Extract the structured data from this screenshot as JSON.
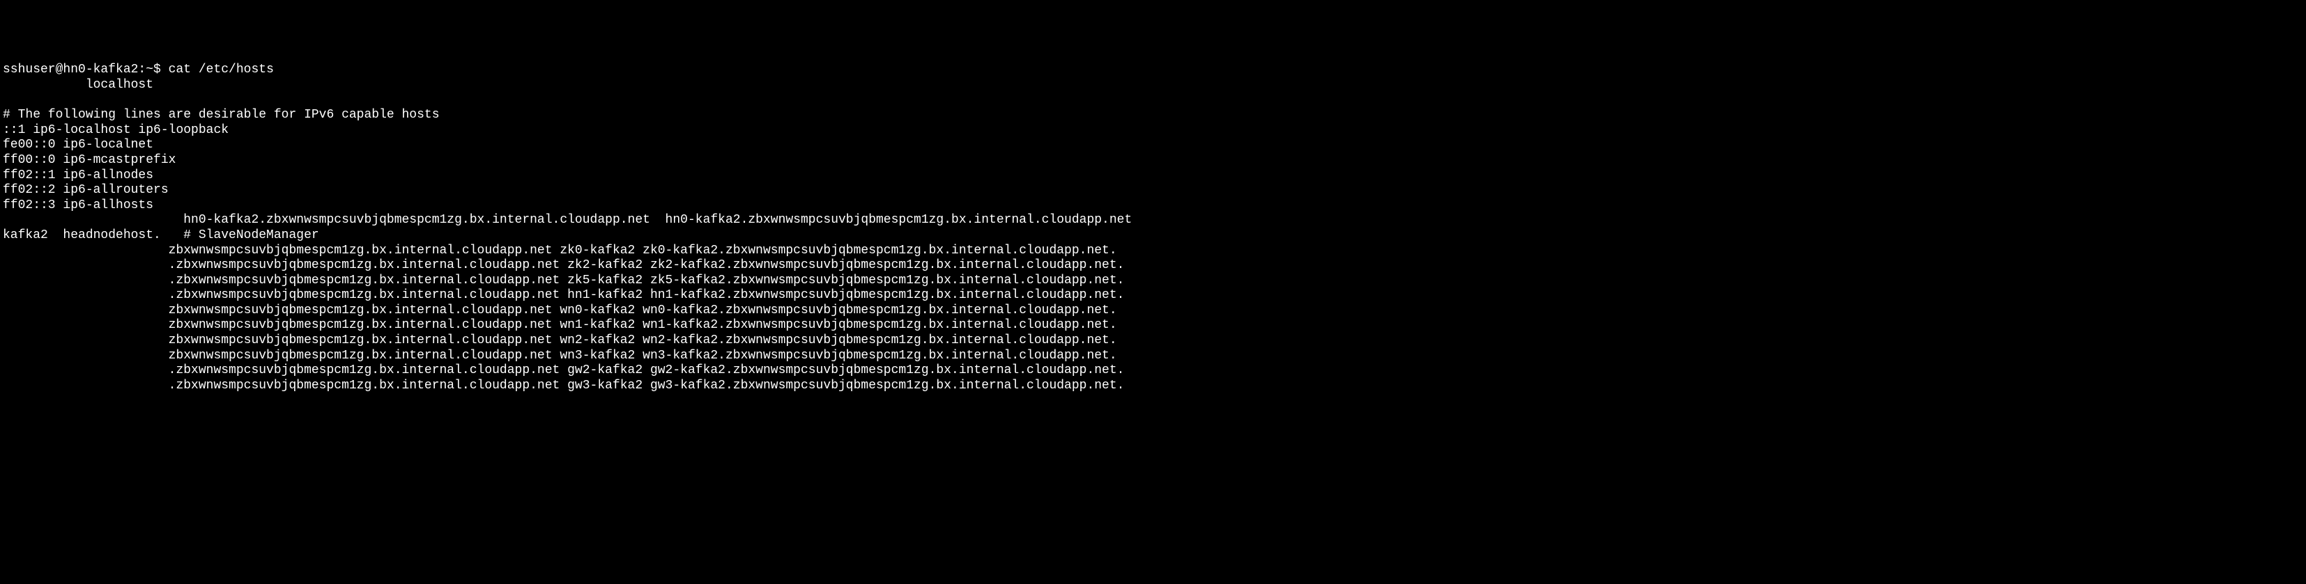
{
  "terminal": {
    "prompt": "sshuser@hn0-kafka2:~$ ",
    "command": "cat /etc/hosts",
    "lines": [
      "           localhost",
      "",
      "# The following lines are desirable for IPv6 capable hosts",
      "::1 ip6-localhost ip6-loopback",
      "fe00::0 ip6-localnet",
      "ff00::0 ip6-mcastprefix",
      "ff02::1 ip6-allnodes",
      "ff02::2 ip6-allrouters",
      "ff02::3 ip6-allhosts",
      "                        hn0-kafka2.zbxwnwsmpcsuvbjqbmespcm1zg.bx.internal.cloudapp.net  hn0-kafka2.zbxwnwsmpcsuvbjqbmespcm1zg.bx.internal.cloudapp.net",
      "kafka2  headnodehost.   # SlaveNodeManager",
      "                      zbxwnwsmpcsuvbjqbmespcm1zg.bx.internal.cloudapp.net zk0-kafka2 zk0-kafka2.zbxwnwsmpcsuvbjqbmespcm1zg.bx.internal.cloudapp.net.",
      "                      .zbxwnwsmpcsuvbjqbmespcm1zg.bx.internal.cloudapp.net zk2-kafka2 zk2-kafka2.zbxwnwsmpcsuvbjqbmespcm1zg.bx.internal.cloudapp.net.",
      "                      .zbxwnwsmpcsuvbjqbmespcm1zg.bx.internal.cloudapp.net zk5-kafka2 zk5-kafka2.zbxwnwsmpcsuvbjqbmespcm1zg.bx.internal.cloudapp.net.",
      "                      .zbxwnwsmpcsuvbjqbmespcm1zg.bx.internal.cloudapp.net hn1-kafka2 hn1-kafka2.zbxwnwsmpcsuvbjqbmespcm1zg.bx.internal.cloudapp.net.",
      "                      zbxwnwsmpcsuvbjqbmespcm1zg.bx.internal.cloudapp.net wn0-kafka2 wn0-kafka2.zbxwnwsmpcsuvbjqbmespcm1zg.bx.internal.cloudapp.net.",
      "                      zbxwnwsmpcsuvbjqbmespcm1zg.bx.internal.cloudapp.net wn1-kafka2 wn1-kafka2.zbxwnwsmpcsuvbjqbmespcm1zg.bx.internal.cloudapp.net.",
      "                      zbxwnwsmpcsuvbjqbmespcm1zg.bx.internal.cloudapp.net wn2-kafka2 wn2-kafka2.zbxwnwsmpcsuvbjqbmespcm1zg.bx.internal.cloudapp.net.",
      "                      zbxwnwsmpcsuvbjqbmespcm1zg.bx.internal.cloudapp.net wn3-kafka2 wn3-kafka2.zbxwnwsmpcsuvbjqbmespcm1zg.bx.internal.cloudapp.net.",
      "                      .zbxwnwsmpcsuvbjqbmespcm1zg.bx.internal.cloudapp.net gw2-kafka2 gw2-kafka2.zbxwnwsmpcsuvbjqbmespcm1zg.bx.internal.cloudapp.net.",
      "                      .zbxwnwsmpcsuvbjqbmespcm1zg.bx.internal.cloudapp.net gw3-kafka2 gw3-kafka2.zbxwnwsmpcsuvbjqbmespcm1zg.bx.internal.cloudapp.net."
    ]
  }
}
